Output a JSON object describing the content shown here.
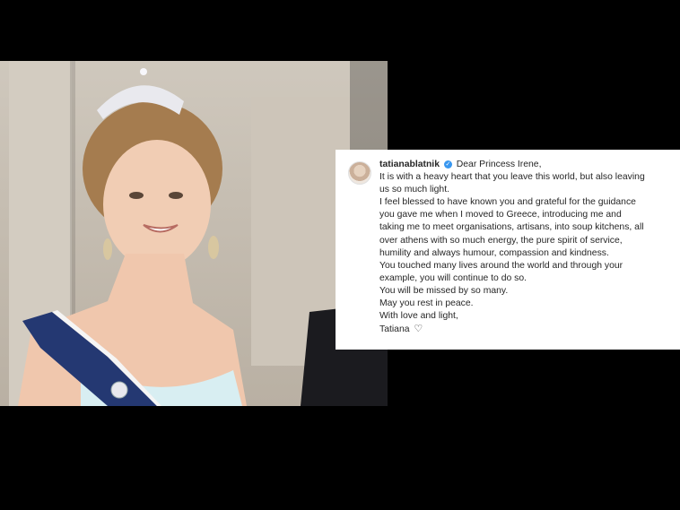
{
  "caption": {
    "username": "tatianablatnik",
    "greeting": "Dear Princess Irene,",
    "lines": [
      "It is with a heavy heart that you leave this world, but also leaving",
      "us so much light.",
      "I feel blessed to have known you and grateful for the guidance",
      "you gave me when I moved to Greece, introducing me and",
      "taking me to meet organisations, artisans, into soup kitchens, all",
      "over athens with so much energy, the pure spirit of service,",
      "humility and always humour, compassion and kindness.",
      "You touched many lives around the world and through your",
      "example, you will continue to do so.",
      "You will be missed by so many.",
      "May you rest in peace.",
      "With love and light,",
      "Tatiana"
    ],
    "verified_icon": "verified-badge-icon",
    "heart_icon": "heart-icon"
  },
  "colors": {
    "background": "#000000",
    "card": "#ffffff",
    "text": "#262626",
    "verified": "#3897f0"
  }
}
